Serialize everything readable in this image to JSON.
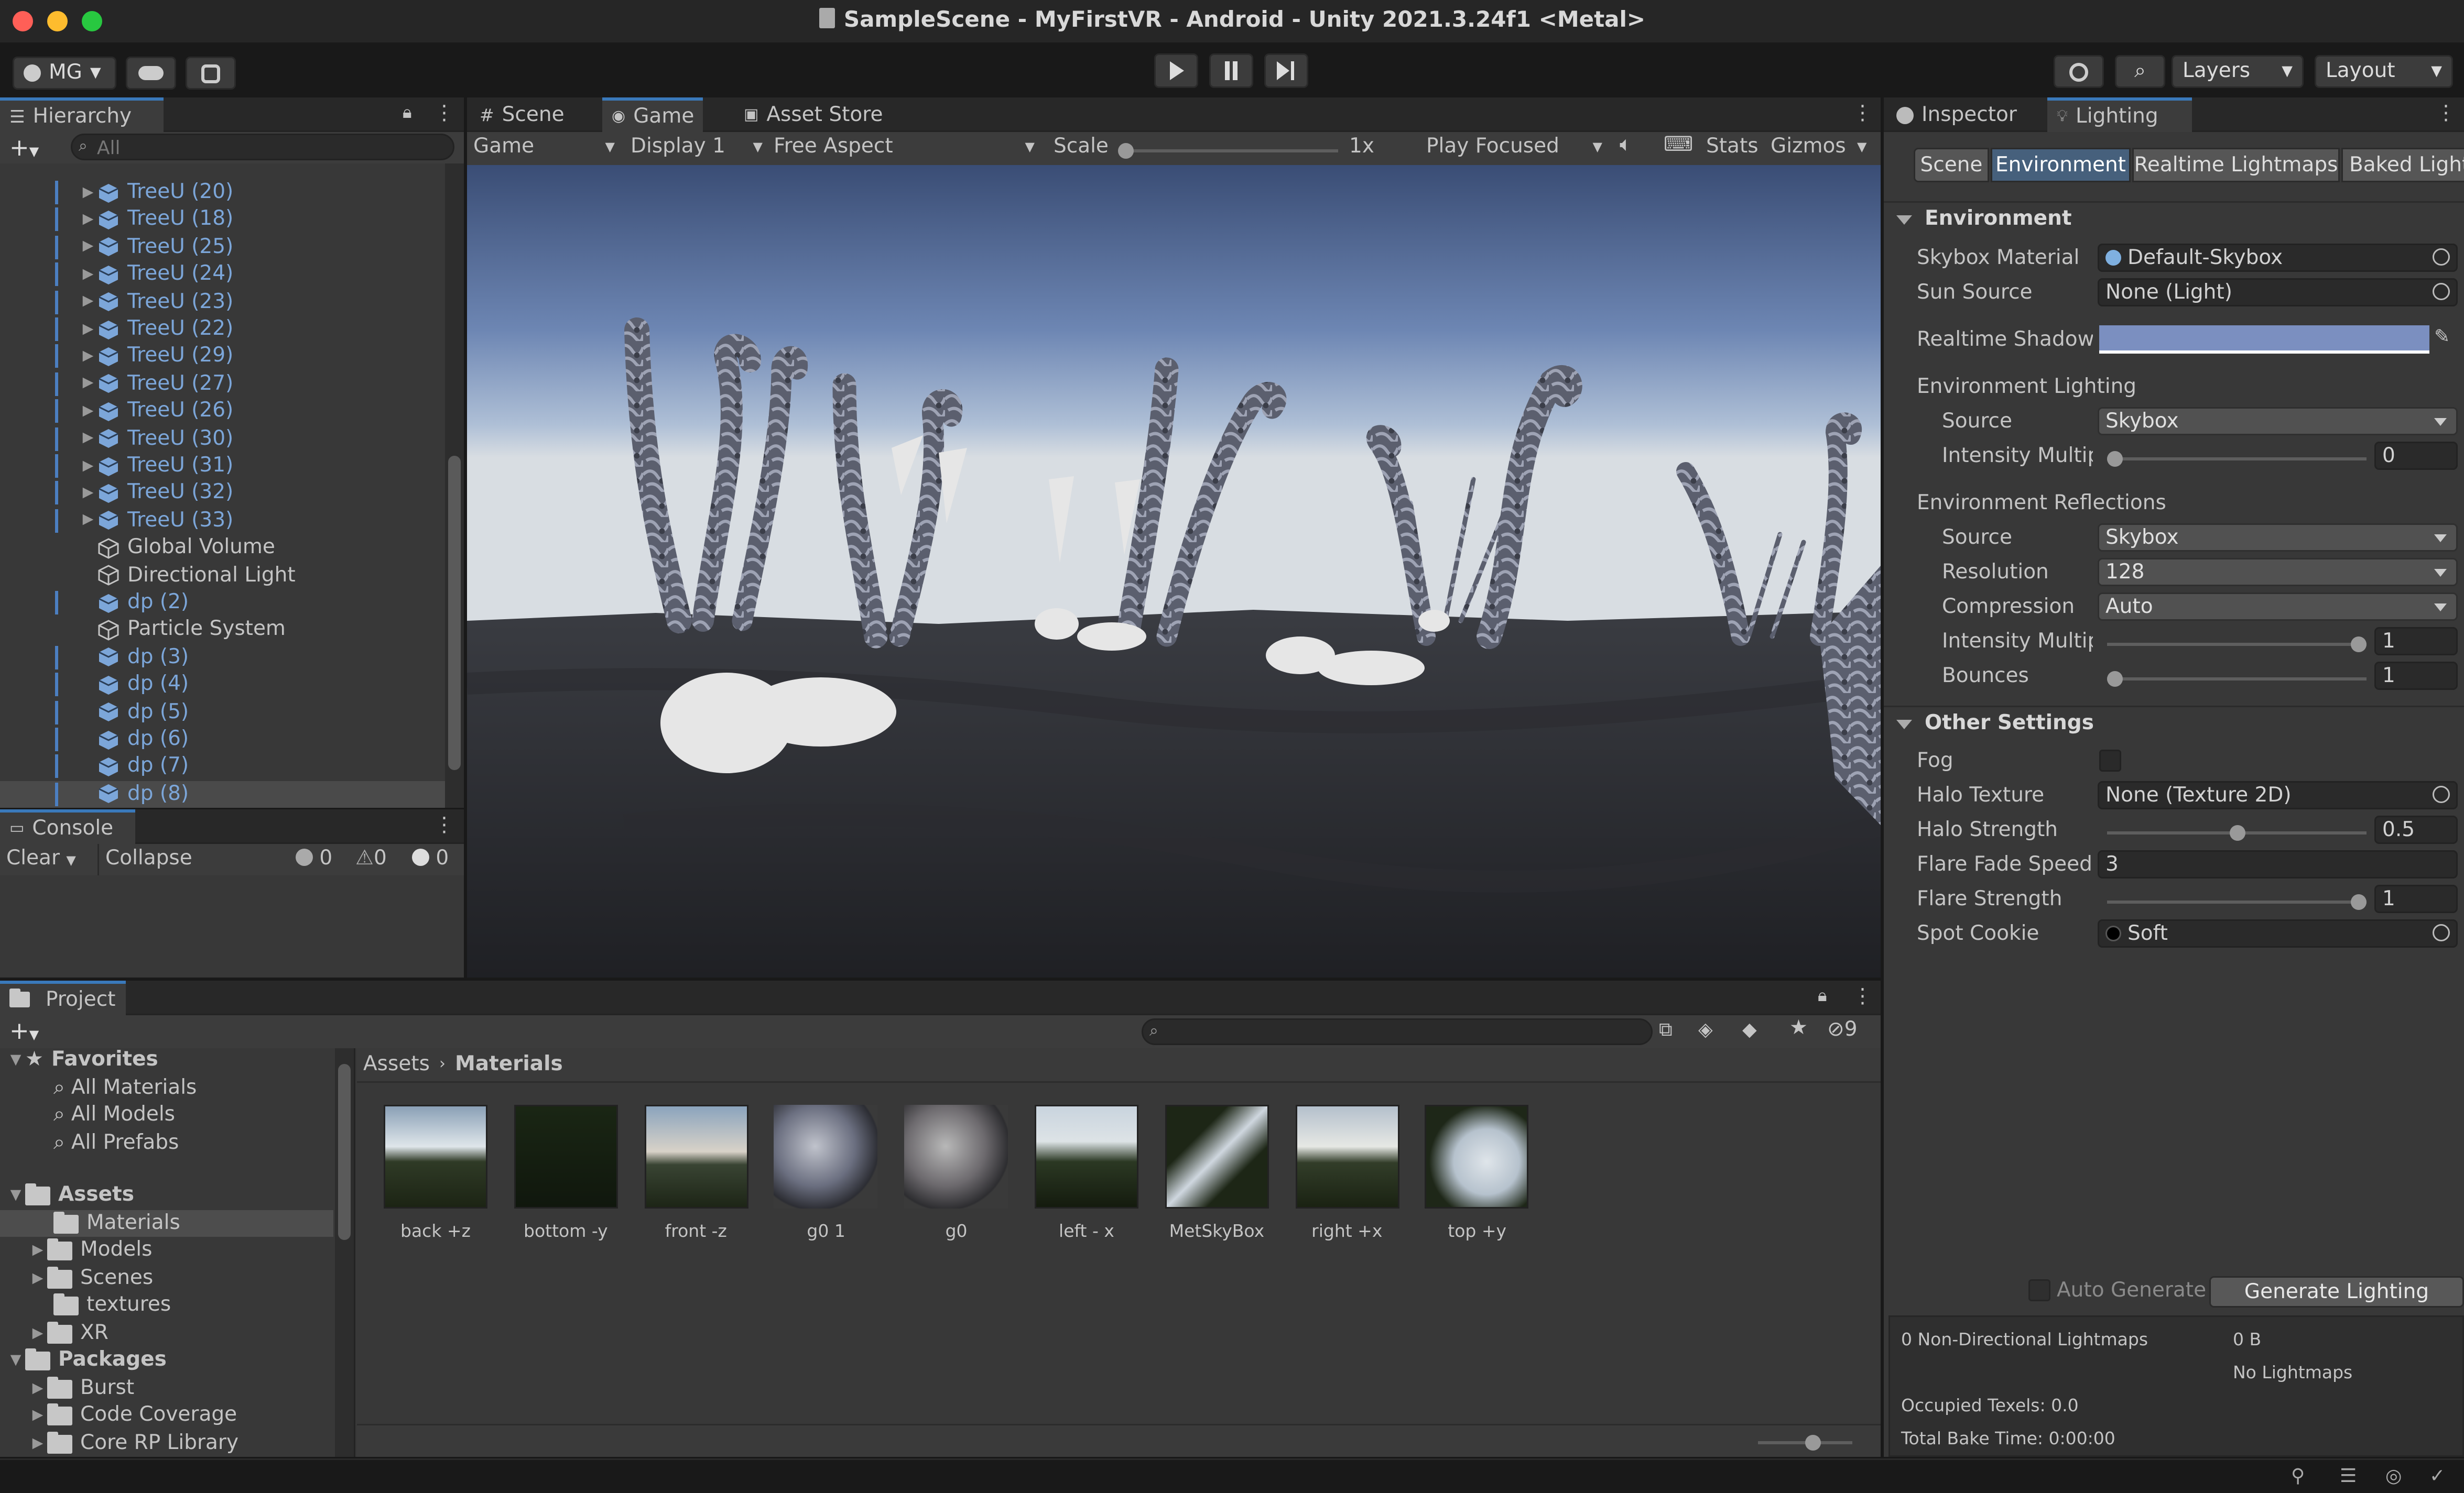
{
  "window": {
    "title": "SampleScene - MyFirstVR - Android - Unity 2021.3.24f1 <Metal>"
  },
  "toolbar": {
    "account": "MG",
    "layers": "Layers",
    "layout": "Layout"
  },
  "hierarchy": {
    "tab": "Hierarchy",
    "search_placeholder": "All",
    "items": [
      {
        "label": "TreeU (20)",
        "prefab": true,
        "expandable": true
      },
      {
        "label": "TreeU (18)",
        "prefab": true,
        "expandable": true
      },
      {
        "label": "TreeU (25)",
        "prefab": true,
        "expandable": true
      },
      {
        "label": "TreeU (24)",
        "prefab": true,
        "expandable": true
      },
      {
        "label": "TreeU (23)",
        "prefab": true,
        "expandable": true
      },
      {
        "label": "TreeU (22)",
        "prefab": true,
        "expandable": true
      },
      {
        "label": "TreeU (29)",
        "prefab": true,
        "expandable": true
      },
      {
        "label": "TreeU (27)",
        "prefab": true,
        "expandable": true
      },
      {
        "label": "TreeU (26)",
        "prefab": true,
        "expandable": true
      },
      {
        "label": "TreeU (30)",
        "prefab": true,
        "expandable": true
      },
      {
        "label": "TreeU (31)",
        "prefab": true,
        "expandable": true
      },
      {
        "label": "TreeU (32)",
        "prefab": true,
        "expandable": true
      },
      {
        "label": "TreeU (33)",
        "prefab": true,
        "expandable": true
      },
      {
        "label": "Global Volume",
        "prefab": false,
        "expandable": false
      },
      {
        "label": "Directional Light",
        "prefab": false,
        "expandable": false
      },
      {
        "label": "dp (2)",
        "prefab": true,
        "expandable": false
      },
      {
        "label": "Particle System",
        "prefab": false,
        "expandable": false
      },
      {
        "label": "dp (3)",
        "prefab": true,
        "expandable": false
      },
      {
        "label": "dp (4)",
        "prefab": true,
        "expandable": false
      },
      {
        "label": "dp (5)",
        "prefab": true,
        "expandable": false
      },
      {
        "label": "dp (6)",
        "prefab": true,
        "expandable": false
      },
      {
        "label": "dp (7)",
        "prefab": true,
        "expandable": false
      },
      {
        "label": "dp (8)",
        "prefab": true,
        "expandable": false
      }
    ]
  },
  "console": {
    "tab": "Console",
    "clear": "Clear",
    "collapse": "Collapse",
    "info_count": "0",
    "warn_count": "0",
    "error_count": "0"
  },
  "game_view": {
    "tabs": [
      "Scene",
      "Game",
      "Asset Store"
    ],
    "mode": "Game",
    "display": "Display 1",
    "aspect": "Free Aspect",
    "scale_label": "Scale",
    "scale_value": "1x",
    "play_mode": "Play Focused",
    "stats": "Stats",
    "gizmos": "Gizmos"
  },
  "inspector": {
    "tabs": [
      "Inspector",
      "Lighting"
    ],
    "subtabs": [
      "Scene",
      "Environment",
      "Realtime Lightmaps",
      "Baked Light"
    ],
    "environment_header": "Environment",
    "skybox_material_label": "Skybox Material",
    "skybox_material_value": "Default-Skybox",
    "sun_source_label": "Sun Source",
    "sun_source_value": "None (Light)",
    "realtime_shadow_label": "Realtime Shadow C",
    "shadow_color": "#7b8fc0",
    "env_lighting_label": "Environment Lighting",
    "source_label": "Source",
    "source_value": "Skybox",
    "intensity_label": "Intensity Multipl",
    "lighting_intensity": "0",
    "lighting_intensity_level": 0,
    "env_reflections_label": "Environment Reflections",
    "refl_source_value": "Skybox",
    "resolution_label": "Resolution",
    "resolution_value": "128",
    "compression_label": "Compression",
    "compression_value": "Auto",
    "refl_intensity": "1",
    "refl_intensity_level": 1,
    "bounces_label": "Bounces",
    "bounces_value": "1",
    "bounces_level": 0,
    "other_header": "Other Settings",
    "fog_label": "Fog",
    "halo_texture_label": "Halo Texture",
    "halo_texture_value": "None (Texture 2D)",
    "halo_strength_label": "Halo Strength",
    "halo_strength_value": "0.5",
    "halo_strength_level": 0.5,
    "flare_fade_label": "Flare Fade Speed",
    "flare_fade_value": "3",
    "flare_strength_label": "Flare Strength",
    "flare_strength_value": "1",
    "flare_strength_level": 1,
    "spot_cookie_label": "Spot Cookie",
    "spot_cookie_value": "Soft",
    "auto_generate": "Auto Generate",
    "generate_lighting": "Generate Lighting",
    "stats_lightmaps": "0 Non-Directional Lightmaps",
    "stats_size": "0 B",
    "stats_no_lightmaps": "No Lightmaps",
    "stats_texels": "Occupied Texels: 0.0",
    "stats_bake_time": "Total Bake Time: 0:00:00"
  },
  "project": {
    "tab": "Project",
    "hidden_count": "9",
    "favorites": "Favorites",
    "fav_items": [
      "All Materials",
      "All Models",
      "All Prefabs"
    ],
    "assets": "Assets",
    "asset_folders": [
      "Materials",
      "Models",
      "Scenes",
      "textures",
      "XR"
    ],
    "packages": "Packages",
    "package_folders": [
      "Burst",
      "Code Coverage",
      "Core RP Library"
    ],
    "breadcrumb": [
      "Assets",
      "Materials"
    ],
    "files": [
      "back +z",
      "bottom -y",
      "front -z",
      "g0 1",
      "g0",
      "left - x",
      "MetSkyBox",
      "right +x",
      "top +y"
    ]
  }
}
